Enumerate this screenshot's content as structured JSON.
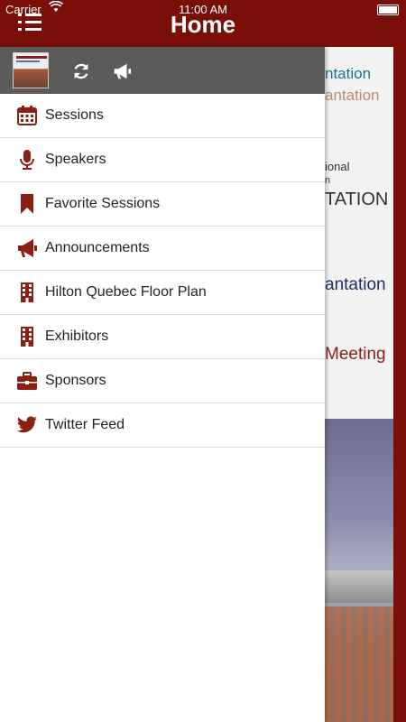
{
  "status_bar": {
    "carrier": "Carrier",
    "time": "11:00 AM"
  },
  "nav": {
    "title": "Home"
  },
  "drawer": {
    "items": [
      {
        "label": "Sessions",
        "icon": "calendar-icon"
      },
      {
        "label": "Speakers",
        "icon": "microphone-icon"
      },
      {
        "label": "Favorite Sessions",
        "icon": "bookmark-icon"
      },
      {
        "label": "Announcements",
        "icon": "megaphone-icon"
      },
      {
        "label": "Hilton Quebec Floor Plan",
        "icon": "building-icon"
      },
      {
        "label": "Exhibitors",
        "icon": "building-icon"
      },
      {
        "label": "Sponsors",
        "icon": "briefcase-icon"
      },
      {
        "label": "Twitter Feed",
        "icon": "twitter-icon"
      }
    ]
  },
  "home_background": {
    "line1": "ntation",
    "line2": "antation",
    "line3": "ional",
    "line4": "n",
    "line5": "TATION",
    "line6": "antation",
    "line7": "Meeting"
  },
  "colors": {
    "accent": "#7a0f0a",
    "icon": "#8a1f14",
    "drawer_header": "#5b5b5b"
  }
}
